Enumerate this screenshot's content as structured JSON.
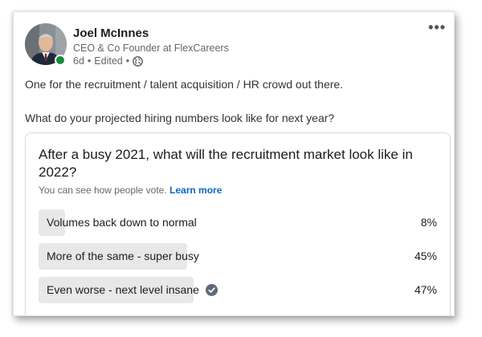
{
  "post": {
    "author": {
      "name": "Joel McInnes",
      "title": "CEO & Co Founder at FlexCareers",
      "time": "6d",
      "edited": "Edited",
      "visibility_icon": "globe-icon",
      "online": true
    },
    "more_icon": "•••",
    "text_line1": "One for the recruitment / talent acquisition / HR crowd out there.",
    "text_line2": "What do your projected hiring numbers look like for next year?"
  },
  "poll": {
    "question": "After a busy 2021, what will the recruitment market look like in 2022?",
    "note": "You can see how people vote.",
    "learn_more": "Learn more",
    "options": [
      {
        "label": "Volumes back down to normal",
        "percent_text": "8%",
        "percent": 8,
        "selected": false
      },
      {
        "label": "More of the same - super busy",
        "percent_text": "45%",
        "percent": 45,
        "selected": false
      },
      {
        "label": "Even worse - next level insane",
        "percent_text": "47%",
        "percent": 47,
        "selected": true
      }
    ]
  },
  "colors": {
    "bar": "#e8e8e8",
    "link": "#0a66c2",
    "presence": "#1a8a3a"
  }
}
